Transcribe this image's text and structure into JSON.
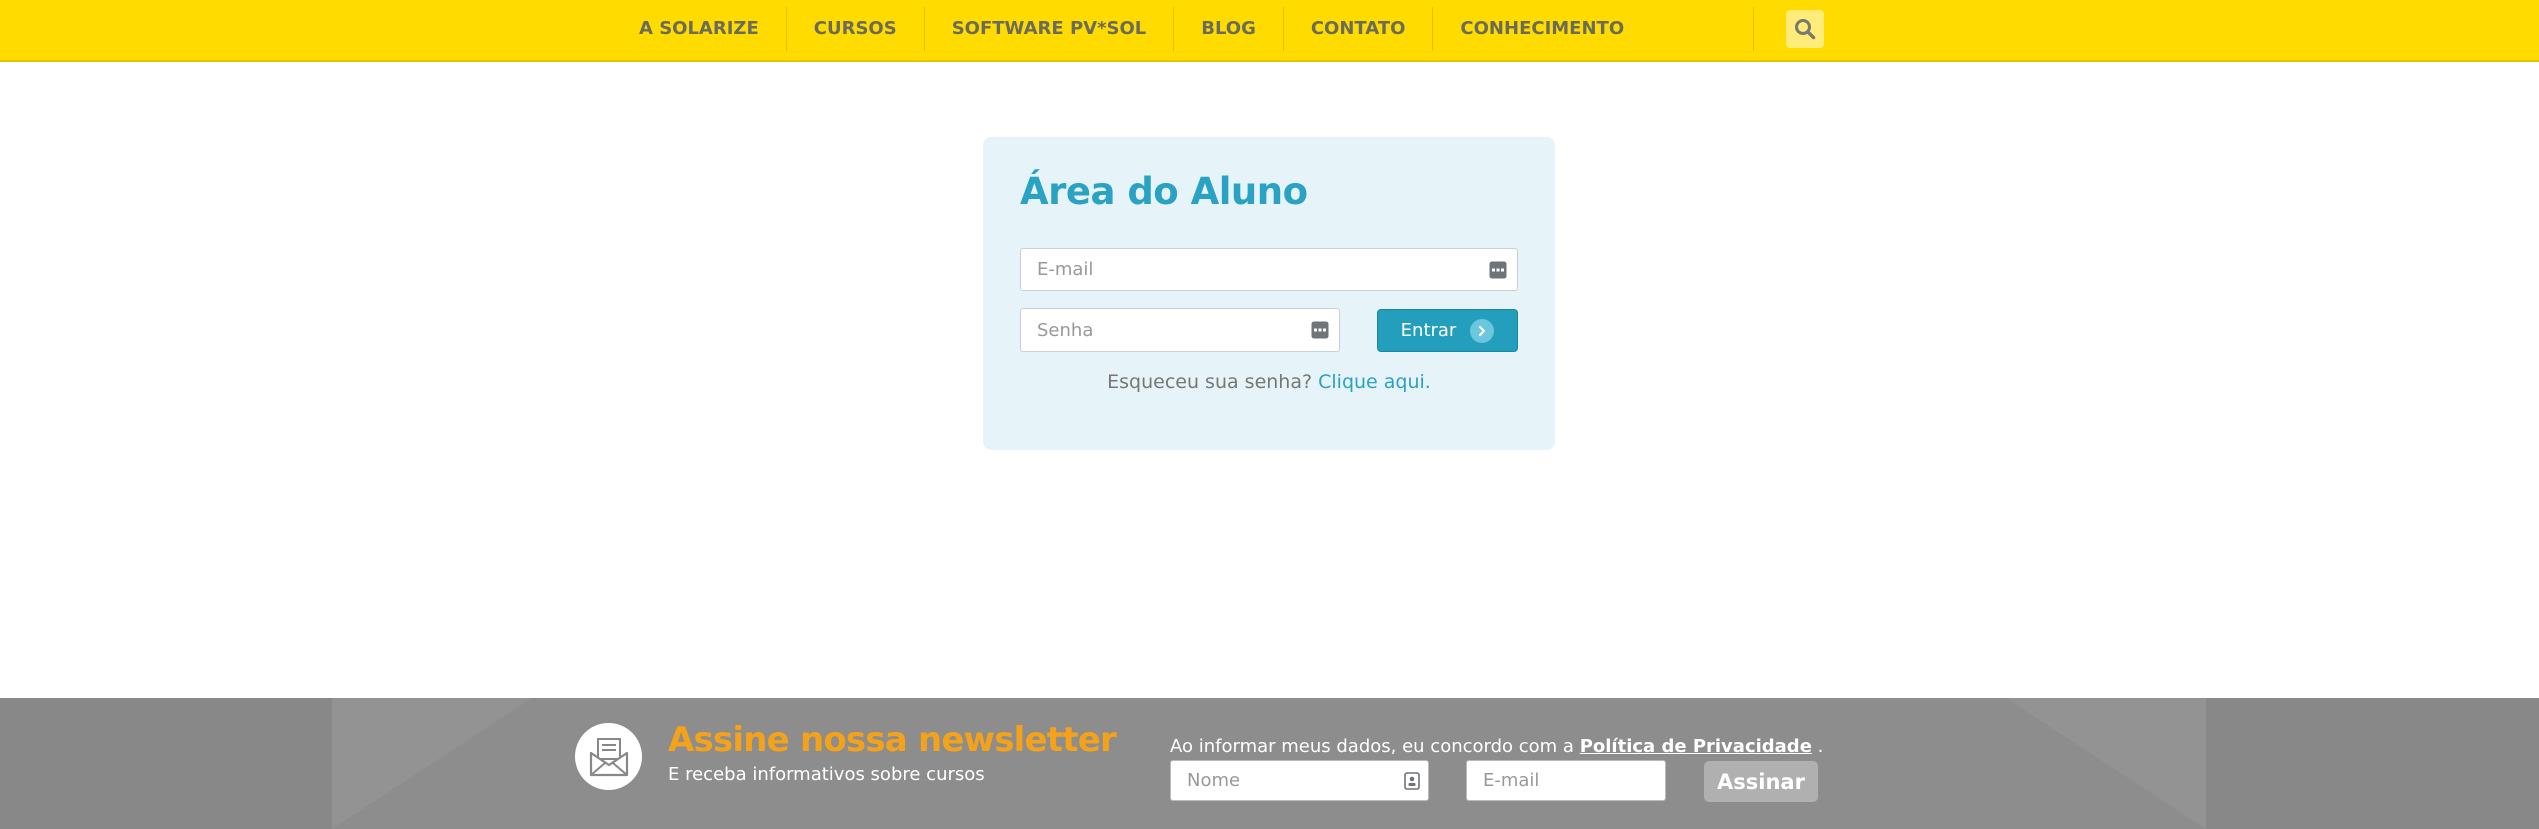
{
  "nav": {
    "items": [
      {
        "label": "A SOLARIZE"
      },
      {
        "label": "CURSOS"
      },
      {
        "label": "SOFTWARE PV*SOL"
      },
      {
        "label": "BLOG"
      },
      {
        "label": "CONTATO"
      },
      {
        "label": "CONHECIMENTO"
      }
    ],
    "search_icon": "search-icon"
  },
  "login": {
    "title": "Área do Aluno",
    "email_placeholder": "E-mail",
    "senha_placeholder": "Senha",
    "entrar_label": "Entrar",
    "forgot_text": "Esqueceu sua senha?",
    "forgot_link": "Clique aqui."
  },
  "newsletter": {
    "title": "Assine nossa newsletter",
    "subtitle": "E receba informativos sobre cursos",
    "consent_text": "Ao informar meus dados, eu concordo com a",
    "consent_link": "Política de Privacidade",
    "consent_end": ".",
    "nome_placeholder": "Nome",
    "email_placeholder": "E-mail",
    "assinar_label": "Assinar"
  },
  "colors": {
    "header_bg": "#ffdb00",
    "accent": "#2aa2c4",
    "newsletter_title": "#f5a21b",
    "footer_bg": "#888888"
  }
}
